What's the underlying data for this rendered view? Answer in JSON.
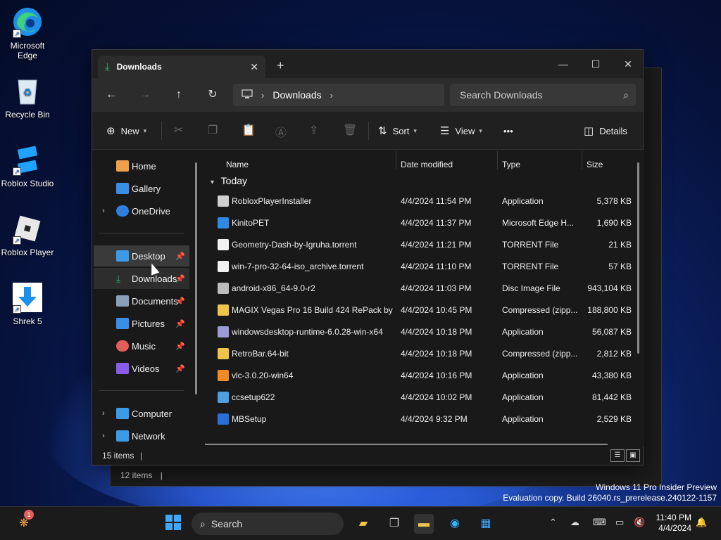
{
  "desktop": {
    "icons": [
      {
        "label": "Microsoft\nEdge",
        "icon": "edge-icon"
      },
      {
        "label": "Recycle Bin",
        "icon": "recycle-bin-icon"
      },
      {
        "label": "Roblox Studio",
        "icon": "roblox-studio-icon"
      },
      {
        "label": "Roblox Player",
        "icon": "roblox-player-icon"
      },
      {
        "label": "Shrek 5",
        "icon": "download-arrow-icon"
      }
    ]
  },
  "back_window": {
    "status_count": "12 items",
    "status_bar": "|"
  },
  "window": {
    "tab_title": "Downloads",
    "tab_close": "✕",
    "new_tab": "+",
    "minimize": "—",
    "maximize": "☐",
    "close": "✕",
    "nav": {
      "back": "←",
      "forward": "→",
      "up": "↑",
      "refresh": "↻"
    },
    "address": {
      "sep1": "›",
      "crumb": "Downloads",
      "sep2": "›"
    },
    "search_placeholder": "Search Downloads",
    "toolbar": {
      "new_label": "New",
      "sort_label": "Sort",
      "view_label": "View",
      "more": "•••",
      "details_label": "Details"
    },
    "sidebar": [
      {
        "label": "Home",
        "color": "#f0a04b"
      },
      {
        "label": "Gallery",
        "color": "#3a8ee6"
      },
      {
        "label": "OneDrive",
        "color": "#2f7fe0"
      },
      {
        "label": "Desktop",
        "color": "#3b9be8"
      },
      {
        "label": "Downloads",
        "color": "#2fb36b"
      },
      {
        "label": "Documents",
        "color": "#8aa0b8"
      },
      {
        "label": "Pictures",
        "color": "#3a8ee6"
      },
      {
        "label": "Music",
        "color": "#e35d5b"
      },
      {
        "label": "Videos",
        "color": "#8a5be6"
      },
      {
        "label": "Computer",
        "color": "#3b9be8"
      },
      {
        "label": "Network",
        "color": "#3b9be8"
      }
    ],
    "columns": {
      "name": "Name",
      "date": "Date modified",
      "type": "Type",
      "size": "Size"
    },
    "group": "Today",
    "files": [
      {
        "name": "RobloxPlayerInstaller",
        "date": "4/4/2024 11:54 PM",
        "type": "Application",
        "size": "5,378 KB",
        "color": "#cfcfcf"
      },
      {
        "name": "KinitoPET",
        "date": "4/4/2024 11:37 PM",
        "type": "Microsoft Edge H...",
        "size": "1,690 KB",
        "color": "#2e8ae6"
      },
      {
        "name": "Geometry-Dash-by-Igruha.torrent",
        "date": "4/4/2024 11:21 PM",
        "type": "TORRENT File",
        "size": "21 KB",
        "color": "#f2f2f2"
      },
      {
        "name": "win-7-pro-32-64-iso_archive.torrent",
        "date": "4/4/2024 11:10 PM",
        "type": "TORRENT File",
        "size": "57 KB",
        "color": "#f2f2f2"
      },
      {
        "name": "android-x86_64-9.0-r2",
        "date": "4/4/2024 11:03 PM",
        "type": "Disc Image File",
        "size": "943,104 KB",
        "color": "#bdbdbd"
      },
      {
        "name": "MAGIX Vegas Pro 16 Build 424 RePack by ...",
        "date": "4/4/2024 10:45 PM",
        "type": "Compressed (zipp...",
        "size": "188,800 KB",
        "color": "#f0c44a"
      },
      {
        "name": "windowsdesktop-runtime-6.0.28-win-x64",
        "date": "4/4/2024 10:18 PM",
        "type": "Application",
        "size": "56,087 KB",
        "color": "#9b9bd8"
      },
      {
        "name": "RetroBar.64-bit",
        "date": "4/4/2024 10:18 PM",
        "type": "Compressed (zipp...",
        "size": "2,812 KB",
        "color": "#f0c44a"
      },
      {
        "name": "vlc-3.0.20-win64",
        "date": "4/4/2024 10:16 PM",
        "type": "Application",
        "size": "43,380 KB",
        "color": "#f08a24"
      },
      {
        "name": "ccsetup622",
        "date": "4/4/2024 10:02 PM",
        "type": "Application",
        "size": "81,442 KB",
        "color": "#4c9fe0"
      },
      {
        "name": "MBSetup",
        "date": "4/4/2024 9:32 PM",
        "type": "Application",
        "size": "2,529 KB",
        "color": "#2a6fd6"
      }
    ],
    "status_count": "15 items",
    "status_bar": "|"
  },
  "watermark": {
    "line1": "Windows 11 Pro Insider Preview",
    "line2": "Evaluation copy. Build 26040.rs_prerelease.240122-1157"
  },
  "taskbar": {
    "search_label": "Search",
    "badge": "1",
    "time": "11:40 PM",
    "date": "4/4/2024"
  }
}
